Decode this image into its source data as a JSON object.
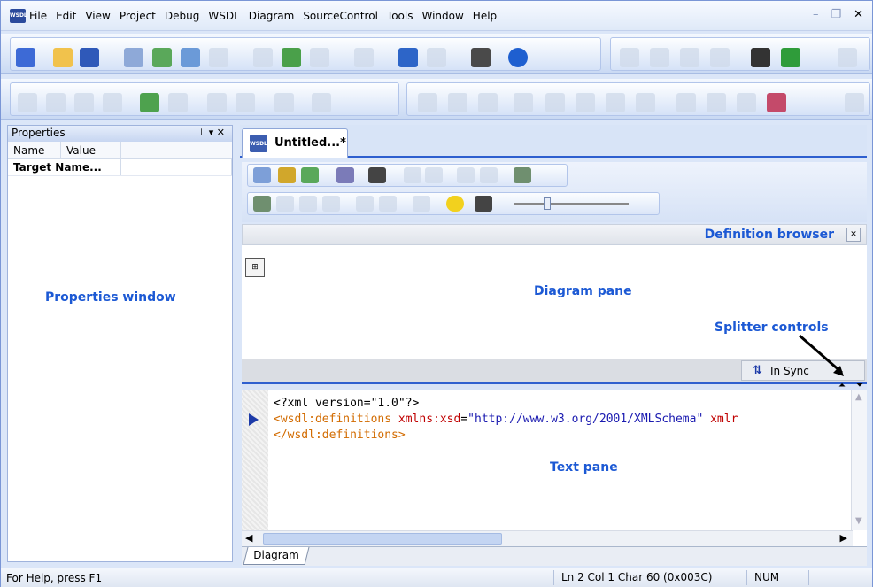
{
  "menubar": {
    "items": [
      "File",
      "Edit",
      "View",
      "Project",
      "Debug",
      "WSDL",
      "Diagram",
      "SourceControl",
      "Tools",
      "Window",
      "Help"
    ],
    "window_controls": [
      "minimize",
      "restore",
      "close"
    ]
  },
  "app_icon_label": "WSDL",
  "properties": {
    "title": "Properties",
    "columns": [
      "Name",
      "Value"
    ],
    "rows": [
      {
        "name": "Target Name...",
        "value": ""
      }
    ]
  },
  "annotations": {
    "properties_window": "Properties window",
    "diagram_pane": "Diagram pane",
    "splitter_controls": "Splitter controls",
    "text_pane": "Text pane"
  },
  "document_tab": {
    "label": "Untitled...*",
    "icon_label": "WSDL"
  },
  "definition_browser": {
    "title": "Definition browser"
  },
  "sync": {
    "label": "In Sync"
  },
  "code": {
    "line1": "<?xml version=\"1.0\"?>",
    "line2_tag": "<wsdl:definitions",
    "line2_attr": "xmlns:xsd",
    "line2_eq": "=",
    "line2_val": "\"http://www.w3.org/2001/XMLSchema\"",
    "line2_tail": "xmlr",
    "line3": "</wsdl:definitions>"
  },
  "bottom_tab": {
    "label": "Diagram"
  },
  "status": {
    "help": "For Help, press F1",
    "position": "Ln 2 Col 1  Char 60 (0x003C)",
    "num": "NUM"
  },
  "colors": {
    "accent": "#1c59d4",
    "tab_border": "#2e5fcf",
    "toolbar_bg": "#dbe6f8"
  }
}
